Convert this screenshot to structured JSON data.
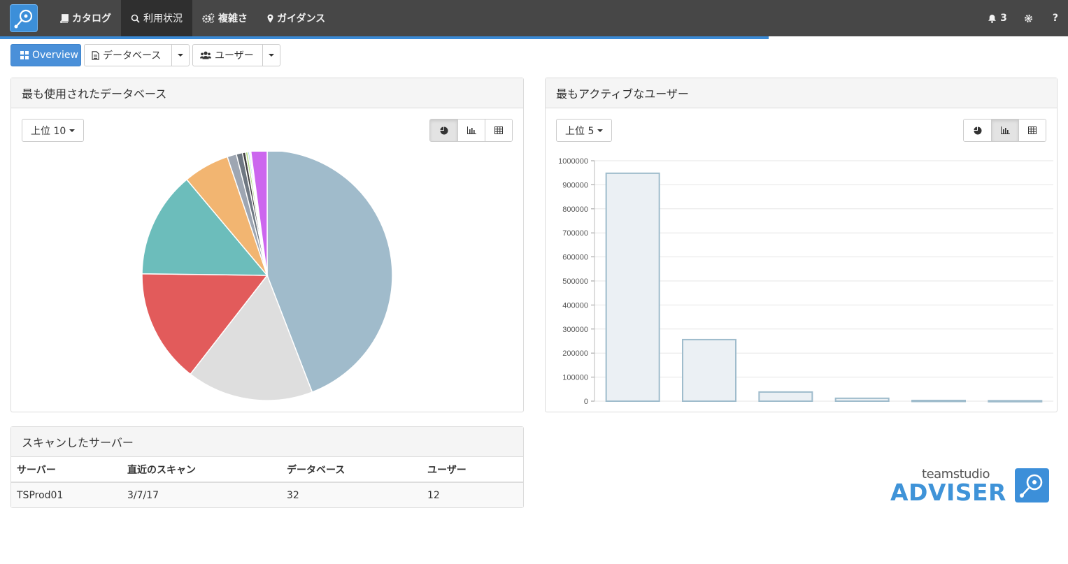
{
  "nav": {
    "items": [
      {
        "label": "カタログ",
        "icon": "book-icon"
      },
      {
        "label": "利用状況",
        "icon": "search-icon"
      },
      {
        "label": "複雑さ",
        "icon": "cogs-icon"
      },
      {
        "label": "ガイダンス",
        "icon": "map-marker-icon"
      }
    ],
    "active_index": 1,
    "notifications_count": "3",
    "help_label": "?",
    "progress": 0.72
  },
  "toolbar": {
    "overview_label": "Overview",
    "database_label": "データベース",
    "users_label": "ユーザー"
  },
  "db_panel": {
    "title": "最も使用されたデータベース",
    "top_label": "上位 10"
  },
  "user_panel": {
    "title": "最もアクティブなユーザー",
    "top_label": "上位 5"
  },
  "servers_panel": {
    "title": "スキャンしたサーバー",
    "columns": [
      "サーバー",
      "直近のスキャン",
      "データベース",
      "ユーザー"
    ],
    "rows": [
      [
        "TSProd01",
        "3/7/17",
        "32",
        "12"
      ]
    ]
  },
  "brand": {
    "small": "teamstudio",
    "big": "ADVISER"
  },
  "colors": {
    "nav_bg": "#474747",
    "accent": "#4a90d9"
  },
  "chart_data": [
    {
      "type": "pie",
      "values": [
        44.5,
        16.5,
        14.8,
        13.8,
        6.0,
        1.2,
        0.8,
        0.4,
        0.3,
        0.2,
        0.2,
        2.1
      ],
      "colors": [
        "#a0bbcb",
        "#dedede",
        "#e25b5b",
        "#6cbdbb",
        "#f2b571",
        "#9ea6b2",
        "#6f7882",
        "#404040",
        "#b8dd8a",
        "#8dc6e8",
        "#f4f4f4",
        "#cc66ee"
      ]
    },
    {
      "type": "bar",
      "values": [
        948000,
        256000,
        38000,
        12000,
        3000,
        2000
      ],
      "ylim": [
        0,
        1000000
      ],
      "yticks": [
        0,
        100000,
        200000,
        300000,
        400000,
        500000,
        600000,
        700000,
        800000,
        900000,
        1000000
      ],
      "fill": "#ebf0f4",
      "stroke": "#9fbccc"
    }
  ]
}
